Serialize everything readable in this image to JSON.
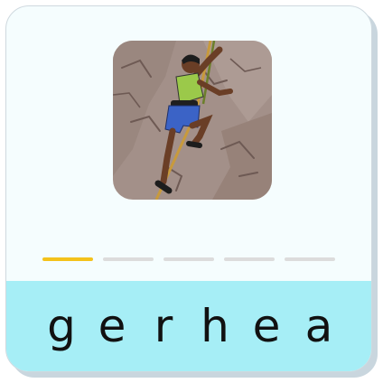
{
  "picture": {
    "icon": "rock-climber-illustration"
  },
  "answer_slots": [
    {
      "state": "active",
      "color": "#f4c21b"
    },
    {
      "state": "empty",
      "color": "#dcdcdc"
    },
    {
      "state": "empty",
      "color": "#dcdcdc"
    },
    {
      "state": "empty",
      "color": "#dcdcdc"
    },
    {
      "state": "empty",
      "color": "#dcdcdc"
    }
  ],
  "letter_tiles": [
    "g",
    "e",
    "r",
    "h",
    "e",
    "a"
  ],
  "colors": {
    "tray": "#a6eef6",
    "card": "#f5fdfe",
    "active_slot": "#f4c21b"
  }
}
